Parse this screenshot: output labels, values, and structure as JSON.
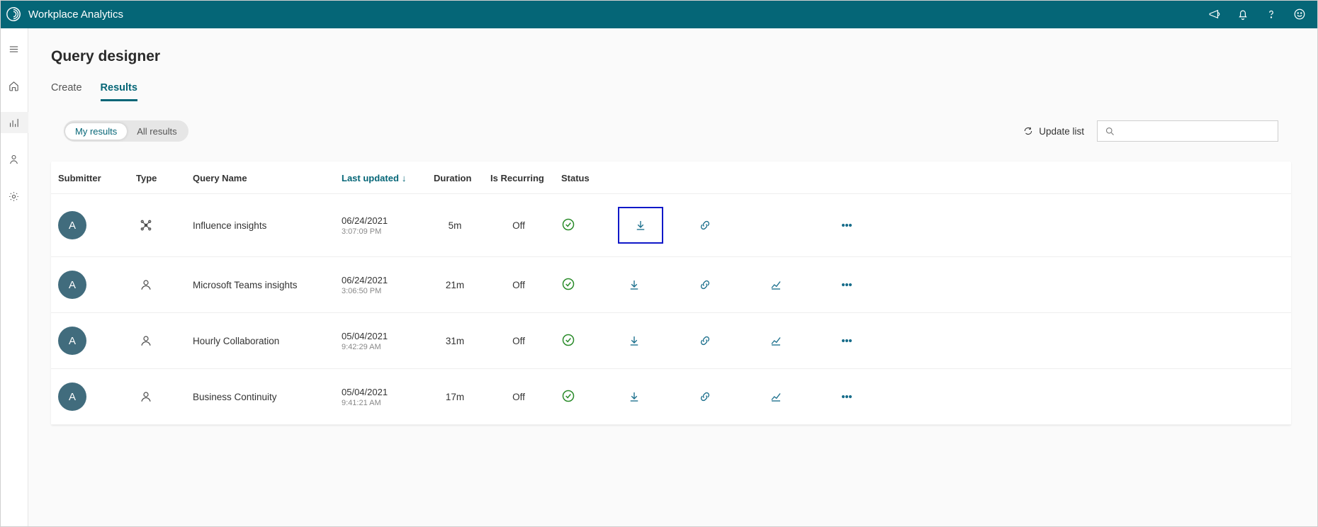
{
  "brand": "Workplace Analytics",
  "page_title": "Query designer",
  "tabs": {
    "create": "Create",
    "results": "Results"
  },
  "filter": {
    "mine": "My results",
    "all": "All results"
  },
  "update_label": "Update list",
  "search_placeholder": "",
  "columns": {
    "submitter": "Submitter",
    "type": "Type",
    "query": "Query Name",
    "last": "Last updated",
    "duration": "Duration",
    "recurring": "Is Recurring",
    "status": "Status"
  },
  "rows": [
    {
      "avatar": "A",
      "type_icon": "network",
      "query": "Influence insights",
      "date": "06/24/2021",
      "time": "3:07:09 PM",
      "duration": "5m",
      "recurring": "Off",
      "status": "success",
      "has_viz": false,
      "highlight_download": true
    },
    {
      "avatar": "A",
      "type_icon": "person",
      "query": "Microsoft Teams insights",
      "date": "06/24/2021",
      "time": "3:06:50 PM",
      "duration": "21m",
      "recurring": "Off",
      "status": "success",
      "has_viz": true,
      "highlight_download": false
    },
    {
      "avatar": "A",
      "type_icon": "person",
      "query": "Hourly Collaboration",
      "date": "05/04/2021",
      "time": "9:42:29 AM",
      "duration": "31m",
      "recurring": "Off",
      "status": "success",
      "has_viz": true,
      "highlight_download": false
    },
    {
      "avatar": "A",
      "type_icon": "person",
      "query": "Business Continuity",
      "date": "05/04/2021",
      "time": "9:41:21 AM",
      "duration": "17m",
      "recurring": "Off",
      "status": "success",
      "has_viz": true,
      "highlight_download": false
    }
  ]
}
